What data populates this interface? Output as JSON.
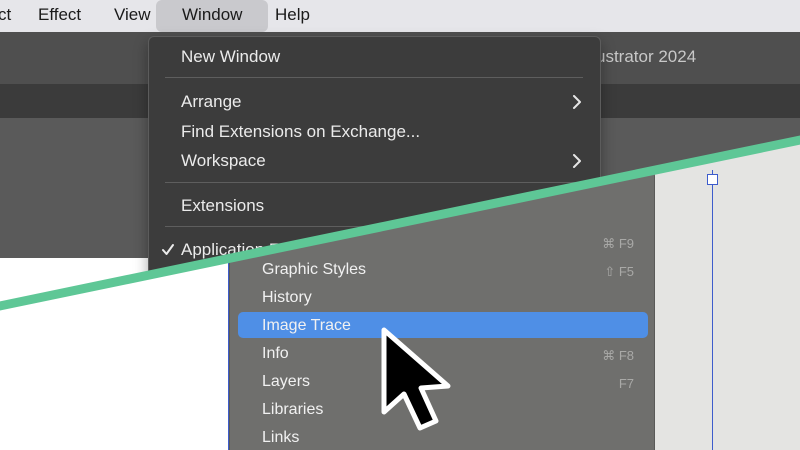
{
  "menubar": {
    "items": [
      "ct",
      "Effect",
      "View",
      "Window",
      "Help"
    ]
  },
  "app": {
    "title": "ustrator 2024"
  },
  "window_menu": {
    "items": [
      {
        "label": "New Window"
      },
      {
        "label": "Arrange",
        "submenu": true
      },
      {
        "label": "Find Extensions on Exchange..."
      },
      {
        "label": "Workspace",
        "submenu": true
      },
      {
        "label": "Extensions"
      },
      {
        "label": "Application Frame",
        "checked": true
      }
    ]
  },
  "panels_menu": {
    "items": [
      {
        "label": "",
        "shortcut": "⌘ F9"
      },
      {
        "label": "Graphic Styles",
        "shortcut": "⇧ F5"
      },
      {
        "label": "History",
        "shortcut": ""
      },
      {
        "label": "Image Trace",
        "shortcut": "",
        "highlighted": true
      },
      {
        "label": "Info",
        "shortcut": "⌘ F8"
      },
      {
        "label": "Layers",
        "shortcut": "F7"
      },
      {
        "label": "Libraries",
        "shortcut": ""
      },
      {
        "label": "Links",
        "shortcut": ""
      }
    ]
  },
  "icons": {
    "submenu": "chevron-right-icon",
    "check": "checkmark-icon",
    "cursor": "arrow-cursor-icon"
  },
  "colors": {
    "divider": "#5ec796",
    "highlight": "#4f8fe6",
    "guide": "#3d5ccc"
  }
}
